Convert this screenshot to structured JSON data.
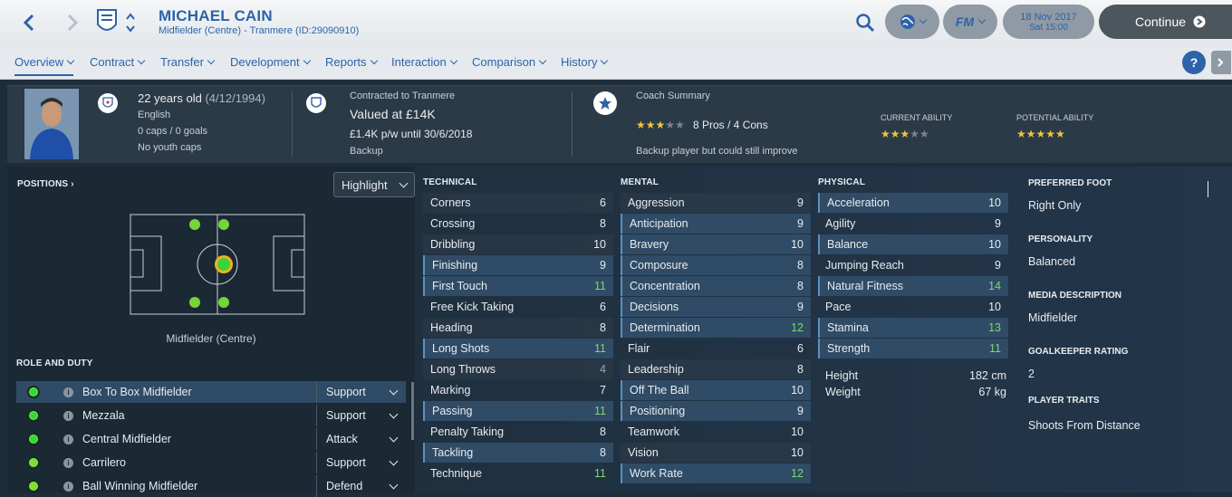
{
  "header": {
    "player_name": "MICHAEL CAIN",
    "player_sub": "Midfielder (Centre) - Tranmere (ID:29090910)",
    "date": "18 Nov 2017",
    "time": "Sat 15:00",
    "continue_label": "Continue",
    "fm_label": "FM"
  },
  "nav": [
    "Overview",
    "Contract",
    "Transfer",
    "Development",
    "Reports",
    "Interaction",
    "Comparison",
    "History"
  ],
  "info": {
    "age": "22 years old",
    "dob": "(4/12/1994)",
    "nationality": "English",
    "caps": "0 caps / 0 goals",
    "youth": "No youth caps",
    "contracted": "Contracted to Tranmere",
    "value": "Valued at £14K",
    "wage": "£1.4K p/w until 30/6/2018",
    "status": "Backup",
    "coach_title": "Coach Summary",
    "pros_cons": "8 Pros / 4 Cons",
    "coach_note": "Backup player but could still improve",
    "ca_label": "CURRENT ABILITY",
    "pa_label": "POTENTIAL ABILITY",
    "coach_stars": 2.5,
    "ca_stars": 2.5,
    "pa_stars": 4.5
  },
  "positions": {
    "title": "POSITIONS",
    "highlight": "Highlight",
    "label": "Midfielder (Centre)",
    "role_title": "ROLE AND DUTY"
  },
  "roles": [
    {
      "name": "Box To Box Midfielder",
      "duty": "Support"
    },
    {
      "name": "Mezzala",
      "duty": "Support"
    },
    {
      "name": "Central Midfielder",
      "duty": "Attack"
    },
    {
      "name": "Carrilero",
      "duty": "Support"
    },
    {
      "name": "Ball Winning Midfielder",
      "duty": "Defend"
    }
  ],
  "technical": {
    "title": "TECHNICAL",
    "rows": [
      {
        "name": "Corners",
        "val": "6",
        "hl": false
      },
      {
        "name": "Crossing",
        "val": "8",
        "hl": false
      },
      {
        "name": "Dribbling",
        "val": "10",
        "hl": false
      },
      {
        "name": "Finishing",
        "val": "9",
        "hl": true
      },
      {
        "name": "First Touch",
        "val": "11",
        "hl": true
      },
      {
        "name": "Free Kick Taking",
        "val": "6",
        "hl": false
      },
      {
        "name": "Heading",
        "val": "8",
        "hl": false
      },
      {
        "name": "Long Shots",
        "val": "11",
        "hl": true
      },
      {
        "name": "Long Throws",
        "val": "4",
        "hl": false
      },
      {
        "name": "Marking",
        "val": "7",
        "hl": false
      },
      {
        "name": "Passing",
        "val": "11",
        "hl": true
      },
      {
        "name": "Penalty Taking",
        "val": "8",
        "hl": false
      },
      {
        "name": "Tackling",
        "val": "8",
        "hl": true
      },
      {
        "name": "Technique",
        "val": "11",
        "hl": false
      }
    ]
  },
  "mental": {
    "title": "MENTAL",
    "rows": [
      {
        "name": "Aggression",
        "val": "9",
        "hl": false
      },
      {
        "name": "Anticipation",
        "val": "9",
        "hl": true
      },
      {
        "name": "Bravery",
        "val": "10",
        "hl": true
      },
      {
        "name": "Composure",
        "val": "8",
        "hl": true
      },
      {
        "name": "Concentration",
        "val": "8",
        "hl": true
      },
      {
        "name": "Decisions",
        "val": "9",
        "hl": true
      },
      {
        "name": "Determination",
        "val": "12",
        "hl": true
      },
      {
        "name": "Flair",
        "val": "6",
        "hl": false
      },
      {
        "name": "Leadership",
        "val": "8",
        "hl": false
      },
      {
        "name": "Off The Ball",
        "val": "10",
        "hl": true
      },
      {
        "name": "Positioning",
        "val": "9",
        "hl": true
      },
      {
        "name": "Teamwork",
        "val": "10",
        "hl": false
      },
      {
        "name": "Vision",
        "val": "10",
        "hl": false
      },
      {
        "name": "Work Rate",
        "val": "12",
        "hl": true
      }
    ]
  },
  "physical": {
    "title": "PHYSICAL",
    "rows": [
      {
        "name": "Acceleration",
        "val": "10",
        "hl": true
      },
      {
        "name": "Agility",
        "val": "9",
        "hl": false
      },
      {
        "name": "Balance",
        "val": "10",
        "hl": true
      },
      {
        "name": "Jumping Reach",
        "val": "9",
        "hl": false
      },
      {
        "name": "Natural Fitness",
        "val": "14",
        "hl": true
      },
      {
        "name": "Pace",
        "val": "10",
        "hl": false
      },
      {
        "name": "Stamina",
        "val": "13",
        "hl": true
      },
      {
        "name": "Strength",
        "val": "11",
        "hl": true
      }
    ],
    "height_label": "Height",
    "height": "182 cm",
    "weight_label": "Weight",
    "weight": "67 kg"
  },
  "right": {
    "foot_title": "PREFERRED FOOT",
    "foot": "Right Only",
    "pers_title": "PERSONALITY",
    "pers": "Balanced",
    "media_title": "MEDIA DESCRIPTION",
    "media": "Midfielder",
    "gk_title": "GOALKEEPER RATING",
    "gk": "2",
    "traits_title": "PLAYER TRAITS",
    "traits": "Shoots From Distance"
  },
  "colors": {
    "accent": "#2d63a8",
    "highlight_value": "#7ed86a",
    "low_value": "#9aa3ab"
  }
}
